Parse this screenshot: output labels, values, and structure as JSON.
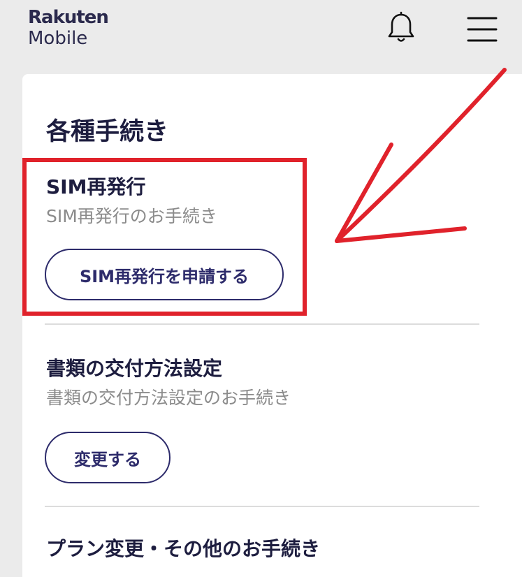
{
  "header": {
    "logo_top": "Rakuten",
    "logo_bottom": "Mobile",
    "bell_icon": "bell-icon",
    "menu_icon": "hamburger-menu-icon"
  },
  "section": {
    "title": "各種手続き"
  },
  "items": [
    {
      "title": "SIM再発行",
      "description": "SIM再発行のお手続き",
      "button": "SIM再発行を申請する"
    },
    {
      "title": "書類の交付方法設定",
      "description": "書類の交付方法設定のお手続き",
      "button": "変更する"
    },
    {
      "title": "プラン変更・その他のお手続き"
    }
  ],
  "colors": {
    "primary": "#2d2b6b",
    "annotation": "#e0222b",
    "background": "#ebebeb",
    "card": "#ffffff"
  }
}
